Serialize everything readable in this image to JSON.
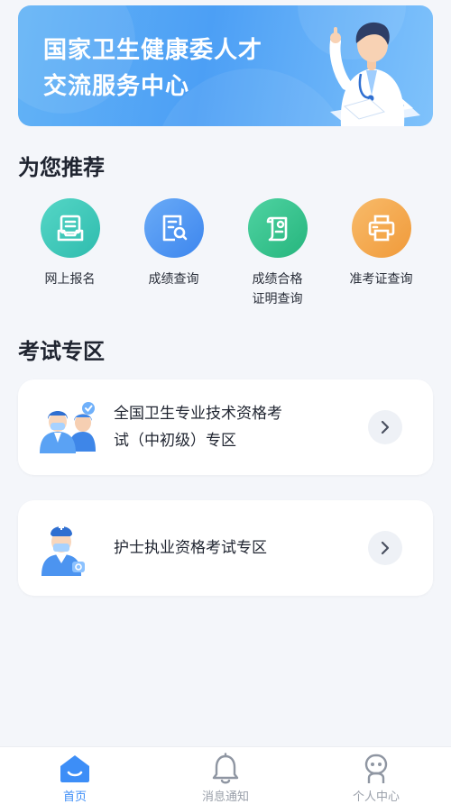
{
  "banner": {
    "title_line1": "国家卫生健康委人才",
    "title_line2": "交流服务中心"
  },
  "recommend": {
    "title": "为您推荐",
    "items": [
      {
        "label": "网上报名",
        "icon": "registration-tray-icon",
        "color": "#3ac7b9"
      },
      {
        "label": "成绩查询",
        "icon": "score-search-icon",
        "color": "#4d96f2"
      },
      {
        "label_line1": "成绩合格",
        "label_line2": "证明查询",
        "icon": "certificate-scroll-icon",
        "color": "#35c18f"
      },
      {
        "label": "准考证查询",
        "icon": "printer-icon",
        "color": "#f4a94d"
      }
    ]
  },
  "exam": {
    "title": "考试专区",
    "cards": [
      {
        "line1": "全国卫生专业技术资格考",
        "line2": "试（中初级）专区",
        "icon": "medical-staff-icon"
      },
      {
        "line1": "护士执业资格考试专区",
        "icon": "nurse-icon"
      }
    ]
  },
  "tabbar": {
    "items": [
      {
        "label": "首页",
        "icon": "home-icon",
        "active": true
      },
      {
        "label": "消息通知",
        "icon": "bell-icon",
        "active": false
      },
      {
        "label": "个人中心",
        "icon": "user-robot-icon",
        "active": false
      }
    ],
    "active_color": "#3d8ef7",
    "inactive_color": "#9aa0aa"
  }
}
